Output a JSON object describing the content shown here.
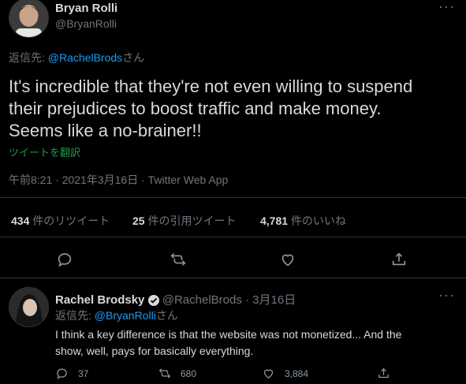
{
  "main_tweet": {
    "author_name": "Bryan Rolli",
    "author_handle": "@BryanRolli",
    "reply_prefix": "返信先: ",
    "reply_to": "@RachelBrods",
    "reply_suffix": "さん",
    "text_line1": "It's incredible that they're not even willing to suspend",
    "text_line2": "their prejudices to boost traffic and make money.",
    "text_line3": "Seems like a no-brainer!!",
    "translate": "ツイートを翻訳",
    "meta": "午前8:21 · 2021年3月16日 · Twitter Web App",
    "more": "···"
  },
  "stats": {
    "retweets_num": "434",
    "retweets_label": "件のリツイート",
    "quotes_num": "25",
    "quotes_label": "件の引用ツイート",
    "likes_num": "4,781",
    "likes_label": "件のいいね"
  },
  "actions": {
    "reply_icon": "reply-icon",
    "retweet_icon": "retweet-icon",
    "like_icon": "heart-icon",
    "share_icon": "share-icon"
  },
  "reply_tweet": {
    "author_name": "Rachel Brodsky",
    "author_handle": "@RachelBrods",
    "date": "· 3月16日",
    "reply_prefix": "返信先: ",
    "reply_to": "@BryanRolli",
    "reply_suffix": "さん",
    "text_line1": "I think a key difference is that the website was not monetized... And the",
    "text_line2": "show, well, pays for basically everything.",
    "reply_count": "37",
    "retweet_count": "680",
    "like_count": "3,884",
    "more": "···"
  },
  "colors": {
    "background": "#000000",
    "link": "#1d9bf0",
    "muted": "#6e767d",
    "translate": "#1d9b4a"
  }
}
